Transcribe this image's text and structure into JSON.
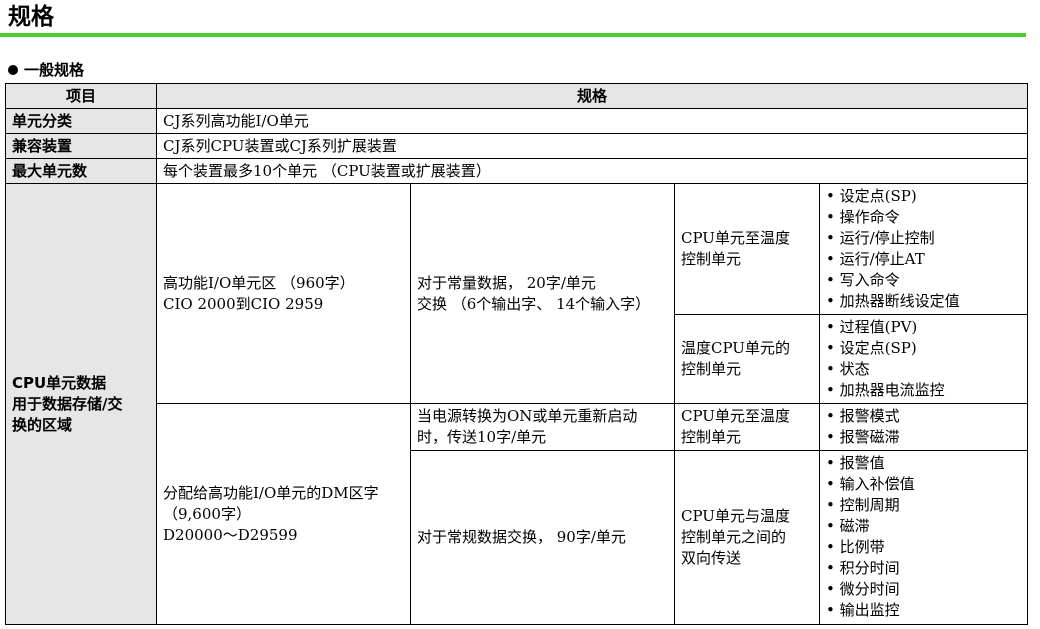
{
  "page_title": "规格",
  "section_title": "一般规格",
  "table": {
    "headers": [
      "项目",
      "规格"
    ],
    "rows": [
      {
        "label": "单元分类",
        "value": "CJ系列高功能I/O单元"
      },
      {
        "label": "兼容装置",
        "value": "CJ系列CPU装置或CJ系列扩展装置"
      },
      {
        "label": "最大单元数",
        "value": "每个装置最多10个单元 （CPU装置或扩展装置）"
      }
    ],
    "cpu_area": {
      "label_lines": [
        "CPU单元数据",
        "用于数据存储/交",
        "换的区域"
      ],
      "io_area": {
        "lines": [
          "高功能I/O单元区 （960字）",
          "CIO 2000到CIO 2959"
        ],
        "exchange_lines": [
          "对于常量数据， 20字/单元",
          "交换 （6个输出字、 14个输入字）"
        ],
        "sub1": {
          "direction_lines": [
            "CPU单元至温度",
            "控制单元"
          ],
          "items": [
            "设定点(SP)",
            "操作命令",
            "运行/停止控制",
            "运行/停止AT",
            "写入命令",
            "加热器断线设定值"
          ]
        },
        "sub2": {
          "direction_lines": [
            "温度CPU单元的",
            "控制单元"
          ],
          "items": [
            "过程值(PV)",
            "设定点(SP)",
            "状态",
            "加热器电流监控"
          ]
        }
      },
      "dm_area": {
        "lines": [
          "分配给高功能I/O单元的DM区字",
          "（9,600字）",
          "D20000～D29599"
        ],
        "sub1": {
          "exchange_lines": [
            "当电源转换为ON或单元重新启动",
            "时，传送10字/单元"
          ],
          "direction_lines": [
            "CPU单元至温度",
            "控制单元"
          ],
          "items": [
            "报警模式",
            "报警磁滞"
          ]
        },
        "sub2": {
          "exchange_lines": [
            "对于常规数据交换， 90字/单元"
          ],
          "direction_lines": [
            "CPU单元与温度",
            "控制单元之间的",
            "双向传送"
          ],
          "items": [
            "报警值",
            "输入补偿值",
            "控制周期",
            "磁滞",
            "比例带",
            "积分时间",
            "微分时间",
            "输出监控"
          ]
        }
      }
    }
  }
}
